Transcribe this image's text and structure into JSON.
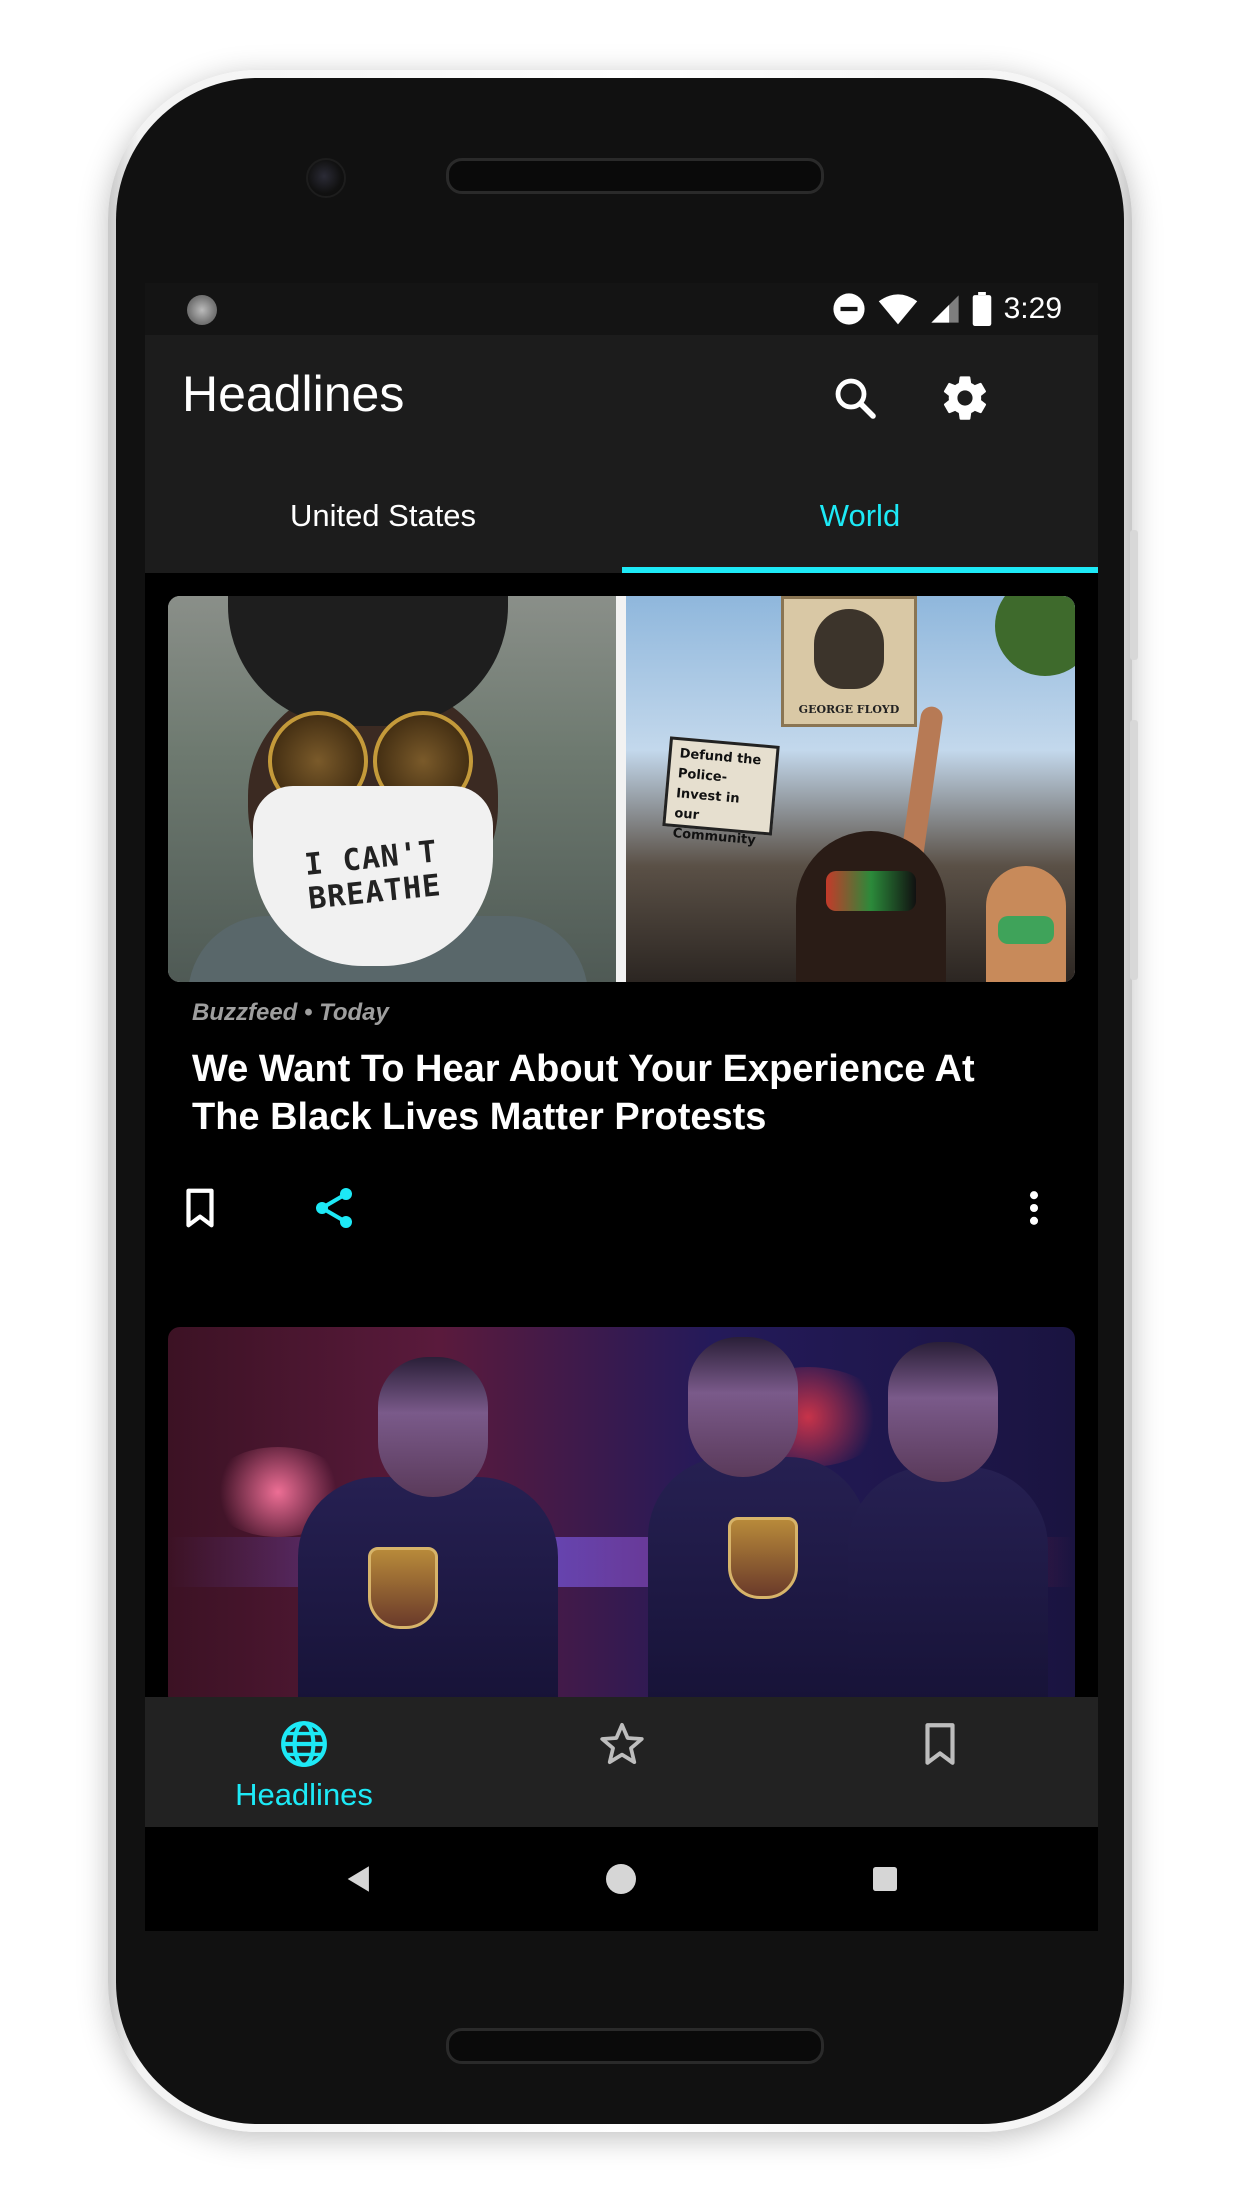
{
  "status_bar": {
    "time": "3:29",
    "icons": [
      "dnd-icon",
      "wifi-icon",
      "signal-icon",
      "battery-icon"
    ]
  },
  "app_bar": {
    "title": "Headlines",
    "actions": [
      "search-icon",
      "settings-icon"
    ]
  },
  "tabs": [
    {
      "label": "United States",
      "active": false
    },
    {
      "label": "World",
      "active": true
    }
  ],
  "colors": {
    "accent": "#1de9f6",
    "background": "#000000",
    "surface": "#1c1c1c",
    "bottom_nav": "#222222",
    "meta_text": "#9e9e9e"
  },
  "articles": [
    {
      "meta": "Buzzfeed • Today",
      "title": "We Want To Hear About Your Experience At The Black Lives Matter Protests",
      "image_text": {
        "mask": "I CAN'T BREATHE",
        "sign_top": "GEORGE FLOYD",
        "sign_mid": "Defund the Police-Invest in our Community"
      },
      "actions": [
        "bookmark-icon",
        "share-icon",
        "more-vert-icon"
      ]
    },
    {
      "meta": "",
      "title": ""
    }
  ],
  "bottom_nav": {
    "items": [
      {
        "icon": "globe-icon",
        "label": "Headlines",
        "active": true
      },
      {
        "icon": "star-icon",
        "label": "",
        "active": false
      },
      {
        "icon": "bookmark-icon",
        "label": "",
        "active": false
      }
    ]
  },
  "system_nav": [
    "back-icon",
    "home-icon",
    "recents-icon"
  ]
}
